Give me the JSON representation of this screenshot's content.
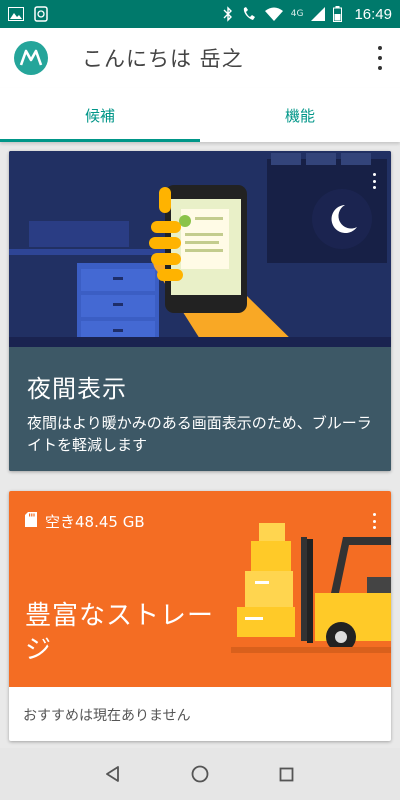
{
  "status_bar": {
    "time": "16:49",
    "network_label": "4G",
    "icons": [
      "image-icon",
      "sync-icon",
      "bluetooth-icon",
      "wifi-calling-icon",
      "wifi-icon",
      "signal-icon",
      "battery-icon"
    ]
  },
  "header": {
    "greeting": "こんにちは 岳之"
  },
  "tabs": [
    {
      "label": "候補",
      "active": true
    },
    {
      "label": "機能",
      "active": false
    }
  ],
  "cards": {
    "night_display": {
      "title": "夜間表示",
      "description": "夜間はより暖かみのある画面表示のため、ブルーライトを軽減します"
    },
    "storage": {
      "free_space": "空き48.45 GB",
      "title": "豊富なストレージ",
      "no_recommendation": "おすすめは現在ありません"
    }
  },
  "colors": {
    "status_bar": "#00796b",
    "accent": "#009688",
    "night_text_panel": "#3d5866",
    "storage_orange": "#f46d23"
  }
}
